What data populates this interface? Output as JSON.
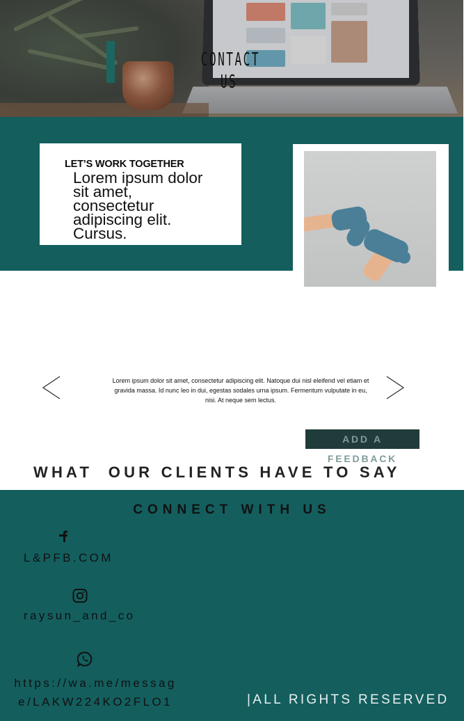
{
  "hero": {
    "title": "CONTACT US"
  },
  "intro": {
    "kicker": "LET’S WORK TOGETHER",
    "body": "Lorem ipsum dolor sit amet, consectetur adipiscing elit. Cursus."
  },
  "testimonial": {
    "text": "Lorem ipsum dolor sit amet, consectetur adipiscing elit. Natoque dui nisl eleifend vel etiam et gravida massa. Id nunc leo in dui, egestas sodales urna ipsum. Fermentum vulputate in eu, nisi. At neque sem lectus."
  },
  "feedback": {
    "button_label": "ADD A FEEDBACK"
  },
  "clients": {
    "heading": "WHAT  OUR CLIENTS HAVE TO SAY"
  },
  "connect": {
    "heading": "CONNECT WITH US",
    "facebook": {
      "icon": "facebook-icon",
      "text": "L&PFB.COM"
    },
    "instagram": {
      "icon": "instagram-icon",
      "text": "raysun_and_co"
    },
    "whatsapp": {
      "icon": "whatsapp-icon",
      "text": "https://wa.me/message/LAKW224KO2FLO1"
    }
  },
  "footer": {
    "rights": "|ALL RIGHTS RESERVED"
  },
  "colors": {
    "teal": "#145e5e",
    "accent_bar": "#1b6661",
    "button_bg": "#1f3b3a",
    "button_text": "#7f9b9a"
  }
}
